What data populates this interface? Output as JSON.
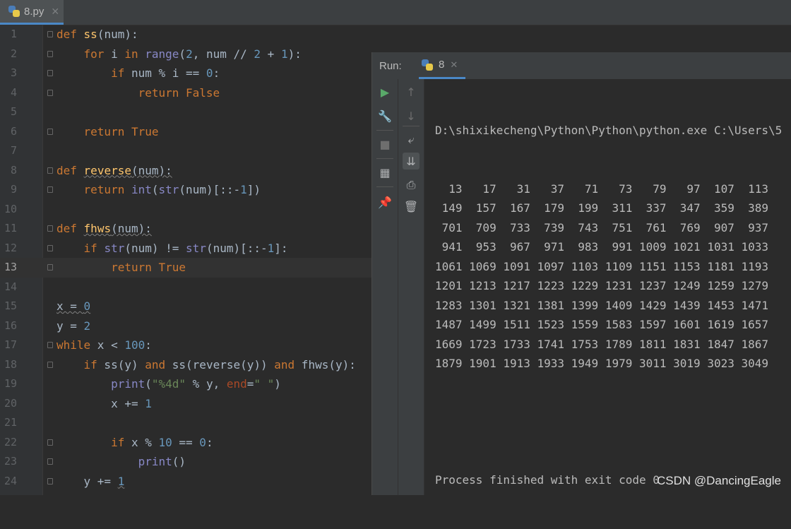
{
  "editor_tab": {
    "filename": "8.py"
  },
  "code_lines": [
    {
      "n": "1",
      "html": "<span class='kw'>def</span> <span class='fn'>ss</span>(num):",
      "fold": true
    },
    {
      "n": "2",
      "html": "    <span class='kw'>for</span> i <span class='kw'>in</span> <span class='bi'>range</span>(<span class='num'>2</span>, num // <span class='num'>2</span> + <span class='num'>1</span>):",
      "fold": true
    },
    {
      "n": "3",
      "html": "        <span class='kw'>if</span> num % i == <span class='num'>0</span>:",
      "fold": true
    },
    {
      "n": "4",
      "html": "            <span class='kw'>return False</span>",
      "fold": true
    },
    {
      "n": "5",
      "html": "",
      "fold": false
    },
    {
      "n": "6",
      "html": "    <span class='kw'>return True</span>",
      "fold": true
    },
    {
      "n": "7",
      "html": "",
      "fold": false
    },
    {
      "n": "8",
      "html": "<span class='kw'>def</span> <span class='fn squig'>reverse</span><span class='squig'>(num):</span>",
      "fold": true
    },
    {
      "n": "9",
      "html": "    <span class='kw'>return</span> <span class='bi'>int</span>(<span class='bi'>str</span>(num)[::-<span class='num'>1</span>])",
      "fold": true
    },
    {
      "n": "10",
      "html": "",
      "fold": false
    },
    {
      "n": "11",
      "html": "<span class='kw'>def</span> <span class='fn squig'>fhws</span><span class='squig'>(num):</span>",
      "fold": true
    },
    {
      "n": "12",
      "html": "    <span class='kw'>if</span> <span class='bi'>str</span>(num) != <span class='bi'>str</span>(num)[::-<span class='num'>1</span>]:",
      "fold": true
    },
    {
      "n": "13",
      "html": "        <span class='kw'>return True</span>",
      "fold": true,
      "current": true
    },
    {
      "n": "14",
      "html": "",
      "fold": false
    },
    {
      "n": "15",
      "html": "<span class='squig'>x = <span class='num'>0</span></span>",
      "fold": false
    },
    {
      "n": "16",
      "html": "y = <span class='num'>2</span>",
      "fold": false
    },
    {
      "n": "17",
      "html": "<span class='kw'>while</span> x &lt; <span class='num'>100</span>:",
      "fold": true
    },
    {
      "n": "18",
      "html": "    <span class='kw'>if</span> ss(y) <span class='kw'>and</span> ss(reverse(y)) <span class='kw'>and</span> fhws(y):",
      "fold": true
    },
    {
      "n": "19",
      "html": "        <span class='bi'>print</span>(<span class='str'>\"%4d\"</span> % y, <span class='par'>end</span>=<span class='str'>\" \"</span>)",
      "fold": false
    },
    {
      "n": "20",
      "html": "        x += <span class='num'>1</span>",
      "fold": false
    },
    {
      "n": "21",
      "html": "",
      "fold": false
    },
    {
      "n": "22",
      "html": "        <span class='kw'>if</span> x % <span class='num'>10</span> == <span class='num'>0</span>:",
      "fold": true
    },
    {
      "n": "23",
      "html": "            <span class='bi'>print</span>()",
      "fold": true
    },
    {
      "n": "24",
      "html": "    y += <span class='num squig'>1</span>",
      "fold": true
    }
  ],
  "run_panel": {
    "label": "Run:",
    "tab_name": "8",
    "command": "D:\\shixikecheng\\Python\\Python\\python.exe C:\\Users\\5",
    "output_rows": [
      "  13   17   31   37   71   73   79   97  107  113",
      " 149  157  167  179  199  311  337  347  359  389",
      " 701  709  733  739  743  751  761  769  907  937",
      " 941  953  967  971  983  991 1009 1021 1031 1033",
      "1061 1069 1091 1097 1103 1109 1151 1153 1181 1193",
      "1201 1213 1217 1223 1229 1231 1237 1249 1259 1279",
      "1283 1301 1321 1381 1399 1409 1429 1439 1453 1471",
      "1487 1499 1511 1523 1559 1583 1597 1601 1619 1657",
      "1669 1723 1733 1741 1753 1789 1811 1831 1847 1867",
      "1879 1901 1913 1933 1949 1979 3011 3019 3023 3049"
    ],
    "finish_message": "Process finished with exit code 0"
  },
  "icons": {
    "run": "play-icon",
    "build": "wrench-icon",
    "stop": "stop-icon",
    "layout": "layout-icon",
    "pin": "pin-icon",
    "up": "arrow-up-icon",
    "down": "arrow-down-icon",
    "wrap": "soft-wrap-icon",
    "scroll": "scroll-to-end-icon",
    "print": "print-icon",
    "trash": "trash-icon"
  },
  "watermark": "CSDN @DancingEagle"
}
